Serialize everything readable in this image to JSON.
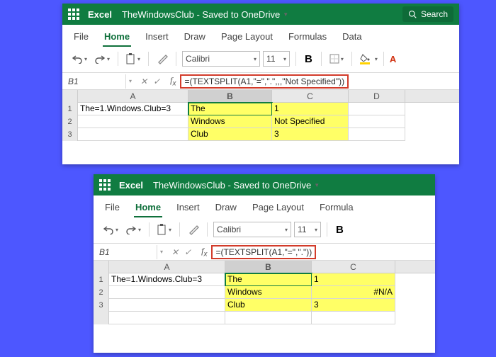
{
  "app_name": "Excel",
  "doc_title": "TheWindowsClub - Saved to OneDrive",
  "search_label": "Search",
  "tabs": {
    "file": "File",
    "home": "Home",
    "insert": "Insert",
    "draw": "Draw",
    "page_layout": "Page Layout",
    "formulas": "Formulas",
    "data": "Data",
    "formula": "Formula"
  },
  "font": {
    "name": "Calibri",
    "size": "11"
  },
  "namebox": "B1",
  "win1": {
    "formula": "=(TEXTSPLIT(A1,\"=\",\".\",,,\"Not Specified\"))",
    "cells": {
      "A": [
        "The=1.Windows.Club=3",
        "",
        ""
      ],
      "B": [
        "The",
        "Windows",
        "Club"
      ],
      "C": [
        "1",
        "Not Specified",
        "3"
      ]
    }
  },
  "win2": {
    "formula": "=(TEXTSPLIT(A1,\"=\",\".\"))",
    "cells": {
      "A": [
        "The=1.Windows.Club=3",
        "",
        ""
      ],
      "B": [
        "The",
        "Windows",
        "Club"
      ],
      "C": [
        "1",
        "#N/A",
        "3"
      ]
    }
  },
  "col_labels": {
    "A": "A",
    "B": "B",
    "C": "C",
    "D": "D"
  },
  "row_labels": [
    "1",
    "2",
    "3"
  ],
  "bold_glyph": "B"
}
